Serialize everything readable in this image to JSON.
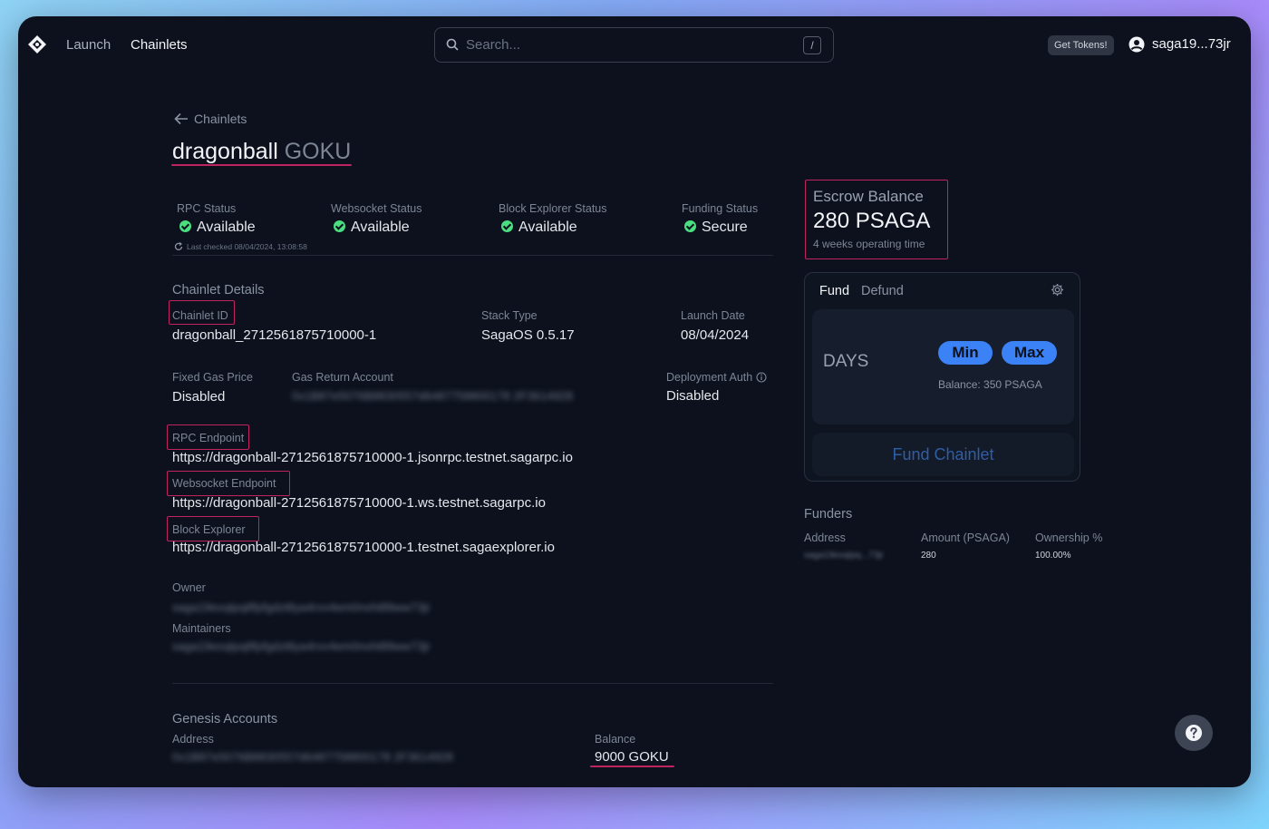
{
  "nav": {
    "launch": "Launch",
    "chainlets": "Chainlets",
    "search_placeholder": "Search...",
    "search_shortcut": "/",
    "get_tokens": "Get Tokens!",
    "user": "saga19...73jr"
  },
  "breadcrumb": "Chainlets",
  "title": {
    "name": "dragonball",
    "token": "GOKU"
  },
  "status": {
    "rpc": {
      "label": "RPC Status",
      "value": "Available"
    },
    "websocket": {
      "label": "Websocket Status",
      "value": "Available"
    },
    "explorer": {
      "label": "Block Explorer Status",
      "value": "Available"
    },
    "funding": {
      "label": "Funding Status",
      "value": "Secure"
    },
    "last_checked": "Last checked 08/04/2024, 13:08:58"
  },
  "details": {
    "heading": "Chainlet Details",
    "chainlet_id_label": "Chainlet ID",
    "chainlet_id": "dragonball_2712561875710000-1",
    "stack_type_label": "Stack Type",
    "stack_type": "SagaOS 0.5.17",
    "launch_date_label": "Launch Date",
    "launch_date": "08/04/2024",
    "fixed_gas_label": "Fixed Gas Price",
    "fixed_gas": "Disabled",
    "gas_return_label": "Gas Return Account",
    "gas_return": "0x1B87e5076B8830557d6487758800178 2F3614928",
    "deploy_auth_label": "Deployment Auth",
    "deploy_auth": "Disabled",
    "rpc_label": "RPC Endpoint",
    "rpc": "https://dragonball-2712561875710000-1.jsonrpc.testnet.sagarpc.io",
    "ws_label": "Websocket Endpoint",
    "ws": "https://dragonball-2712561875710000-1.ws.testnet.sagarpc.io",
    "explorer_label": "Block Explorer",
    "explorer": "https://dragonball-2712561875710000-1.testnet.sagaexplorer.io",
    "owner_label": "Owner",
    "owner": "saga19exqtpq8fpfgdzttlya4rvv4em0nvht89ww73jr",
    "maintainers_label": "Maintainers",
    "maintainers": "saga19exqtpq8fpfgdzttlya4rvv4em0nvht89ww73jr"
  },
  "genesis": {
    "heading": "Genesis Accounts",
    "address_label": "Address",
    "address": "0x1B87e5076B8830557d6487758800178 2F3614928",
    "balance_label": "Balance",
    "balance": "9000 GOKU"
  },
  "escrow": {
    "label": "Escrow Balance",
    "value": "280 PSAGA",
    "sub": "4 weeks operating time"
  },
  "fund": {
    "tab_fund": "Fund",
    "tab_defund": "Defund",
    "days": "DAYS",
    "min": "Min",
    "max": "Max",
    "balance": "Balance: 350 PSAGA",
    "button": "Fund Chainlet"
  },
  "funders": {
    "heading": "Funders",
    "col_address": "Address",
    "col_amount": "Amount (PSAGA)",
    "col_ownership": "Ownership %",
    "row": {
      "address": "saga19exqtpq...73jr",
      "amount": "280",
      "ownership": "100.00%"
    }
  },
  "colors": {
    "accent": "#3b82f6",
    "highlight": "#c0245f",
    "success": "#4ade80",
    "bg": "#0c111d"
  }
}
